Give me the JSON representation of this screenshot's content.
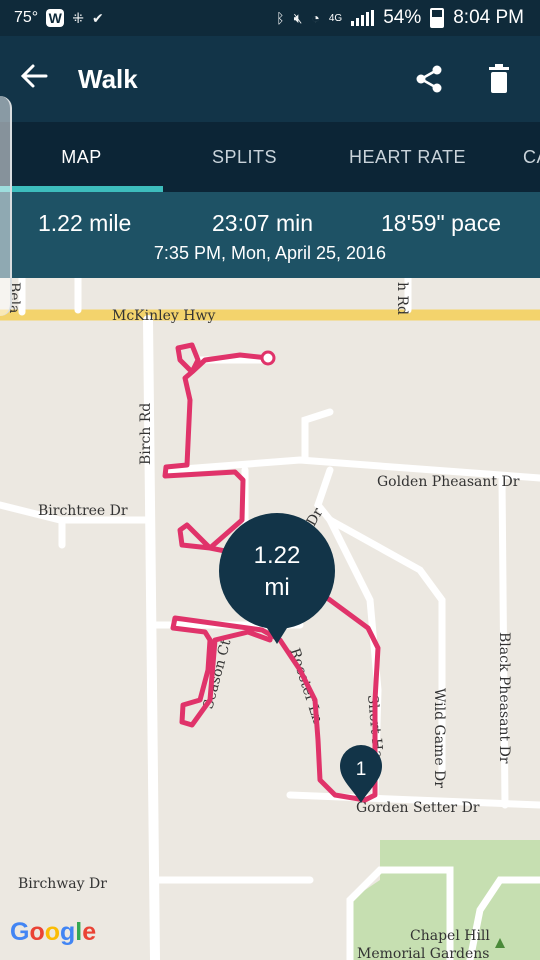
{
  "status_bar": {
    "temperature": "75°",
    "battery_percent": "54%",
    "time": "8:04 PM",
    "network": "4G"
  },
  "app_bar": {
    "title": "Walk",
    "back_icon": "arrow-left-icon",
    "share_icon": "share-icon",
    "delete_icon": "trash-icon"
  },
  "tabs": [
    {
      "label": "MAP",
      "active": true
    },
    {
      "label": "SPLITS",
      "active": false
    },
    {
      "label": "HEART RATE",
      "active": false
    },
    {
      "label": "CA",
      "active": false
    }
  ],
  "summary": {
    "distance": "1.22 mile",
    "duration": "23:07 min",
    "pace": "18'59\" pace",
    "datetime": "7:35 PM, Mon, April 25, 2016"
  },
  "map": {
    "streets": {
      "mckinley": "McKinley Hwy",
      "birch": "Birch Rd",
      "birchtree": "Birchtree Dr",
      "golden_pheasant": "Golden Pheasant Dr",
      "rooster": "Rooster Ln",
      "season": "Season Ct",
      "short": "Short Ha",
      "wild_game": "Wild Game Dr",
      "black_pheasant": "Black Pheasant Dr",
      "gorden_setter": "Gorden Setter Dr",
      "birchway": "Birchway Dr",
      "bela": "Bela",
      "h_rd": "h Rd",
      "dr_frag": "Dr"
    },
    "poi": {
      "line1": "Chapel Hill",
      "line2": "Memorial Gardens"
    },
    "distance_marker": {
      "value": "1.22",
      "unit": "mi"
    },
    "mile_marker": "1",
    "route_color": "#e0336a",
    "attribution": "Google"
  }
}
